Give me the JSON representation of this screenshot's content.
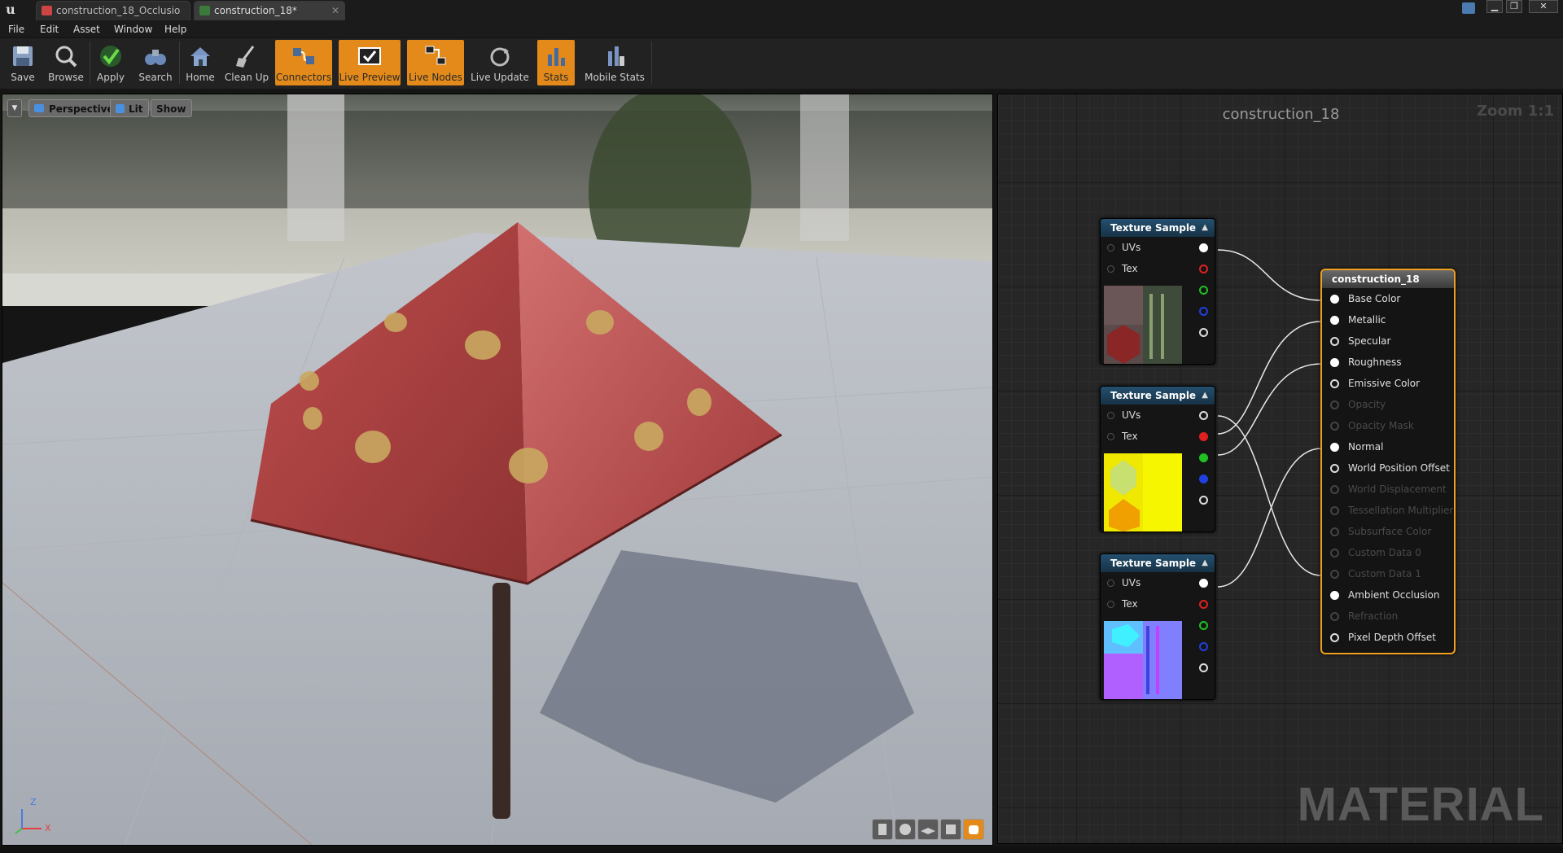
{
  "window": {
    "tabs": [
      {
        "label": "construction_18_Occlusio",
        "active": false
      },
      {
        "label": "construction_18*",
        "active": true
      }
    ],
    "controls": {
      "minimize": "▁",
      "restore": "❐",
      "close": "✕"
    }
  },
  "menu": [
    "File",
    "Edit",
    "Asset",
    "Window",
    "Help"
  ],
  "toolbar": [
    {
      "label": "Save",
      "icon": "save-icon",
      "on": false
    },
    {
      "label": "Browse",
      "icon": "browse-icon",
      "on": false
    },
    {
      "label": "Apply",
      "icon": "apply-check-icon",
      "on": false
    },
    {
      "label": "Search",
      "icon": "search-binoculars-icon",
      "on": false
    },
    {
      "label": "Home",
      "icon": "home-icon",
      "on": false
    },
    {
      "label": "Clean Up",
      "icon": "broom-icon",
      "on": false
    },
    {
      "label": "Connectors",
      "icon": "connectors-icon",
      "on": true
    },
    {
      "label": "Live Preview",
      "icon": "live-preview-icon",
      "on": true
    },
    {
      "label": "Live Nodes",
      "icon": "live-nodes-icon",
      "on": true
    },
    {
      "label": "Live Update",
      "icon": "live-update-icon",
      "on": false
    },
    {
      "label": "Stats",
      "icon": "stats-icon",
      "on": true
    },
    {
      "label": "Mobile Stats",
      "icon": "mobile-stats-icon",
      "on": false
    }
  ],
  "viewport": {
    "perspective": "Perspective",
    "lit": "Lit",
    "show": "Show",
    "axis": {
      "z": "Z",
      "x": "X"
    }
  },
  "graph": {
    "title": "construction_18",
    "zoom": "Zoom 1:1",
    "watermark": "MATERIAL",
    "texture_nodes": [
      {
        "title": "Texture Sample",
        "inputs": [
          "UVs",
          "Tex"
        ]
      },
      {
        "title": "Texture Sample",
        "inputs": [
          "UVs",
          "Tex"
        ]
      },
      {
        "title": "Texture Sample",
        "inputs": [
          "UVs",
          "Tex"
        ]
      }
    ],
    "material_node": {
      "title": "construction_18",
      "pins": [
        {
          "label": "Base Color",
          "active": true,
          "connected": true
        },
        {
          "label": "Metallic",
          "active": true,
          "connected": true
        },
        {
          "label": "Specular",
          "active": true,
          "connected": false
        },
        {
          "label": "Roughness",
          "active": true,
          "connected": true
        },
        {
          "label": "Emissive Color",
          "active": true,
          "connected": false
        },
        {
          "label": "Opacity",
          "active": false,
          "connected": false
        },
        {
          "label": "Opacity Mask",
          "active": false,
          "connected": false
        },
        {
          "label": "Normal",
          "active": true,
          "connected": true
        },
        {
          "label": "World Position Offset",
          "active": true,
          "connected": false
        },
        {
          "label": "World Displacement",
          "active": false,
          "connected": false
        },
        {
          "label": "Tessellation Multiplier",
          "active": false,
          "connected": false
        },
        {
          "label": "Subsurface Color",
          "active": false,
          "connected": false
        },
        {
          "label": "Custom Data 0",
          "active": false,
          "connected": false
        },
        {
          "label": "Custom Data 1",
          "active": false,
          "connected": false
        },
        {
          "label": "Ambient Occlusion",
          "active": true,
          "connected": true
        },
        {
          "label": "Refraction",
          "active": false,
          "connected": false
        },
        {
          "label": "Pixel Depth Offset",
          "active": true,
          "connected": false
        }
      ]
    }
  },
  "colors": {
    "toggle_on": "#e38a1a",
    "selected_node_border": "#f0a020",
    "pin_red": "#e02020",
    "pin_green": "#20c020",
    "pin_blue": "#2040e0"
  }
}
